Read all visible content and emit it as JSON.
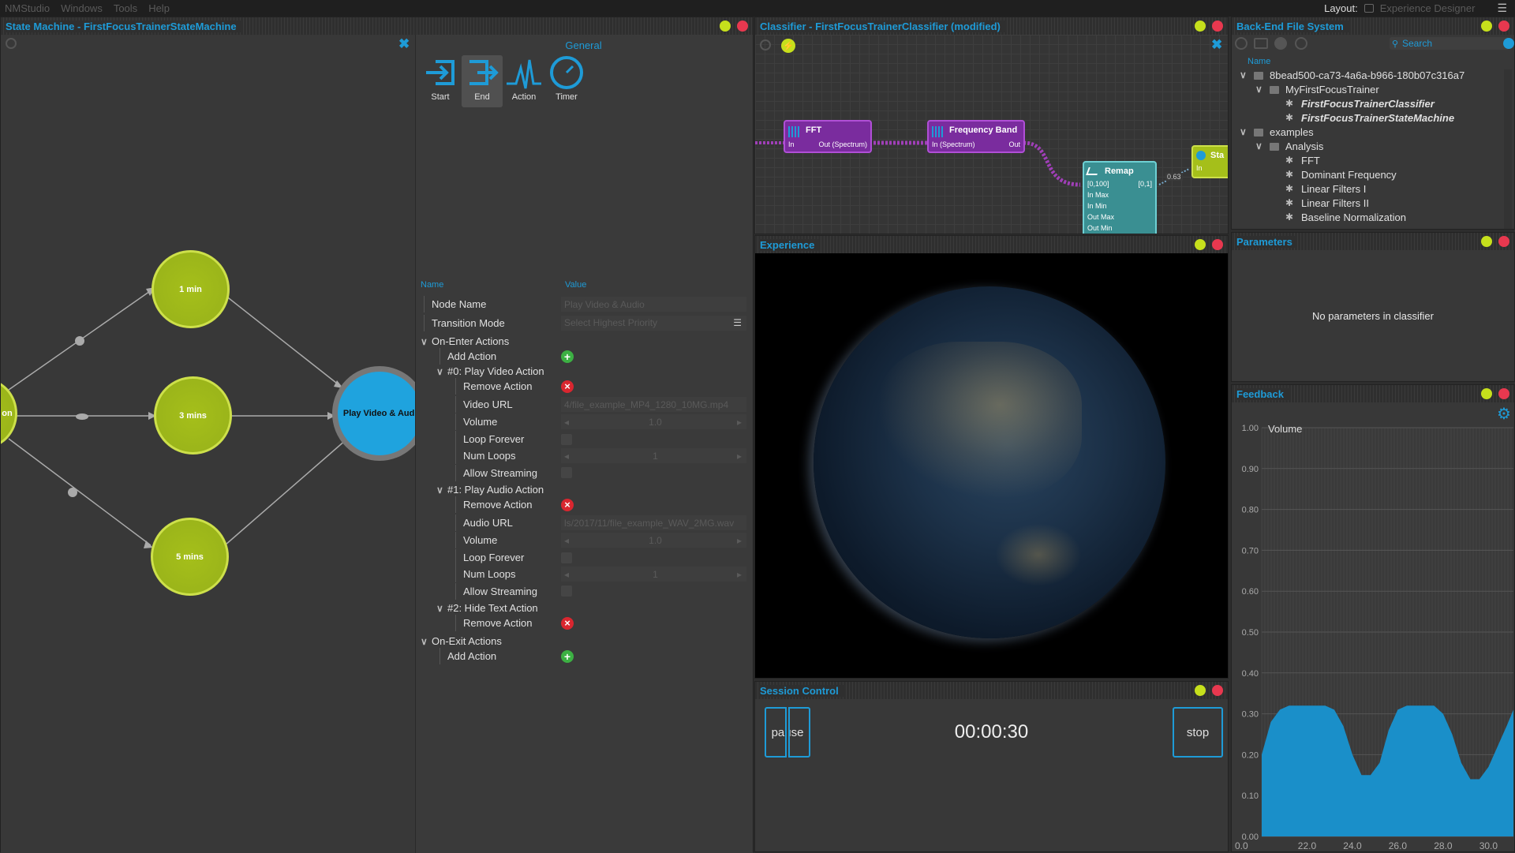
{
  "menu": {
    "items": [
      "NMStudio",
      "Windows",
      "Tools",
      "Help"
    ],
    "layout_label": "Layout:",
    "layout_value": "Experience Designer"
  },
  "state_machine": {
    "title": "State Machine - FirstFocusTrainerStateMachine",
    "nodes": [
      {
        "label": "on"
      },
      {
        "label": "1 min"
      },
      {
        "label": "3 mins"
      },
      {
        "label": "5 mins"
      },
      {
        "label": "Play Video & Audio"
      }
    ],
    "toolbox_title": "General",
    "tools": [
      {
        "label": "Start",
        "icon": "start-icon"
      },
      {
        "label": "End",
        "icon": "end-icon"
      },
      {
        "label": "Action",
        "icon": "action-icon"
      },
      {
        "label": "Timer",
        "icon": "timer-icon"
      }
    ],
    "props_header": {
      "name": "Name",
      "value": "Value"
    },
    "props": [
      {
        "name": "Node Name",
        "value": "Play Video & Audio",
        "indent": 0,
        "kind": "field"
      },
      {
        "name": "Transition Mode",
        "value": "Select Highest Priority",
        "indent": 0,
        "kind": "select"
      },
      {
        "name": "On-Enter Actions",
        "indent": 0,
        "kind": "group"
      },
      {
        "name": "Add Action",
        "indent": 1,
        "kind": "add"
      },
      {
        "name": "#0: Play Video Action",
        "indent": 1,
        "kind": "group"
      },
      {
        "name": "Remove Action",
        "indent": 2,
        "kind": "remove"
      },
      {
        "name": "Video URL",
        "value": "4/file_example_MP4_1280_10MG.mp4",
        "indent": 2,
        "kind": "field"
      },
      {
        "name": "Volume",
        "value": "1.0",
        "indent": 2,
        "kind": "spin"
      },
      {
        "name": "Loop Forever",
        "indent": 2,
        "kind": "check"
      },
      {
        "name": "Num Loops",
        "value": "1",
        "indent": 2,
        "kind": "spin"
      },
      {
        "name": "Allow Streaming",
        "indent": 2,
        "kind": "check"
      },
      {
        "name": "#1: Play Audio Action",
        "indent": 1,
        "kind": "group"
      },
      {
        "name": "Remove Action",
        "indent": 2,
        "kind": "remove"
      },
      {
        "name": "Audio URL",
        "value": "ls/2017/11/file_example_WAV_2MG.wav",
        "indent": 2,
        "kind": "field"
      },
      {
        "name": "Volume",
        "value": "1.0",
        "indent": 2,
        "kind": "spin"
      },
      {
        "name": "Loop Forever",
        "indent": 2,
        "kind": "check"
      },
      {
        "name": "Num Loops",
        "value": "1",
        "indent": 2,
        "kind": "spin"
      },
      {
        "name": "Allow Streaming",
        "indent": 2,
        "kind": "check"
      },
      {
        "name": "#2: Hide Text Action",
        "indent": 1,
        "kind": "group"
      },
      {
        "name": "Remove Action",
        "indent": 2,
        "kind": "remove"
      },
      {
        "name": "On-Exit Actions",
        "indent": 0,
        "kind": "group"
      },
      {
        "name": "Add Action",
        "indent": 1,
        "kind": "add"
      }
    ]
  },
  "classifier": {
    "title": "Classifier - FirstFocusTrainerClassifier (modified)",
    "nodes": {
      "fft": {
        "title": "FFT",
        "in": "In",
        "out": "Out (Spectrum)"
      },
      "band": {
        "title": "Frequency Band",
        "in": "In (Spectrum)",
        "out": "Out"
      },
      "remap": {
        "title": "Remap",
        "range_in": "[0,100]",
        "range_out": "[0,1]",
        "ports": [
          "In Max",
          "In Min",
          "Out Max",
          "Out Min"
        ]
      },
      "state": {
        "title": "Sta",
        "in": "In"
      },
      "value_badge": "0.63"
    }
  },
  "filesystem": {
    "title": "Back-End File System",
    "search_placeholder": "Search",
    "col_header": "Name",
    "items": [
      {
        "label": "8bead500-ca73-4a6a-b966-180b07c316a7",
        "indent": 0,
        "type": "folder"
      },
      {
        "label": "MyFirstFocusTrainer",
        "indent": 1,
        "type": "folder"
      },
      {
        "label": "FirstFocusTrainerClassifier",
        "indent": 2,
        "type": "classifier"
      },
      {
        "label": "FirstFocusTrainerStateMachine",
        "indent": 2,
        "type": "statemachine"
      },
      {
        "label": "examples",
        "indent": 0,
        "type": "group"
      },
      {
        "label": "Analysis",
        "indent": 1,
        "type": "group"
      },
      {
        "label": "FFT",
        "indent": 2,
        "type": "item"
      },
      {
        "label": "Dominant Frequency",
        "indent": 2,
        "type": "item"
      },
      {
        "label": "Linear Filters I",
        "indent": 2,
        "type": "item"
      },
      {
        "label": "Linear Filters II",
        "indent": 2,
        "type": "item"
      },
      {
        "label": "Baseline Normalization",
        "indent": 2,
        "type": "item"
      }
    ]
  },
  "experience": {
    "title": "Experience"
  },
  "parameters": {
    "title": "Parameters",
    "empty_text": "No parameters in classifier"
  },
  "session": {
    "title": "Session Control",
    "pause_label": "pause",
    "timer": "00:00:30",
    "stop_label": "stop"
  },
  "feedback": {
    "title": "Feedback"
  },
  "chart_data": {
    "type": "area",
    "series": [
      {
        "name": "Volume",
        "x": [
          20.0,
          20.4,
          20.8,
          21.2,
          21.6,
          22.0,
          22.4,
          22.8,
          23.2,
          23.6,
          24.0,
          24.4,
          24.8,
          25.2,
          25.6,
          26.0,
          26.4,
          26.8,
          27.2,
          27.6,
          28.0,
          28.4,
          28.8,
          29.2,
          29.6,
          30.0,
          30.4,
          30.8,
          31.1
        ],
        "y": [
          0.2,
          0.28,
          0.31,
          0.32,
          0.32,
          0.32,
          0.32,
          0.32,
          0.31,
          0.27,
          0.2,
          0.15,
          0.15,
          0.18,
          0.26,
          0.31,
          0.32,
          0.32,
          0.32,
          0.32,
          0.3,
          0.25,
          0.18,
          0.14,
          0.14,
          0.17,
          0.22,
          0.27,
          0.31
        ]
      }
    ],
    "xticks": [
      "0.0",
      "22.0",
      "24.0",
      "26.0",
      "28.0",
      "30.0"
    ],
    "yticks": [
      "0.00",
      "0.10",
      "0.20",
      "0.30",
      "0.40",
      "0.50",
      "0.60",
      "0.70",
      "0.80",
      "0.90",
      "1.00"
    ],
    "ylim": [
      0,
      1
    ],
    "xlim": [
      20.0,
      31.1
    ],
    "color": "#1a8fc9"
  }
}
